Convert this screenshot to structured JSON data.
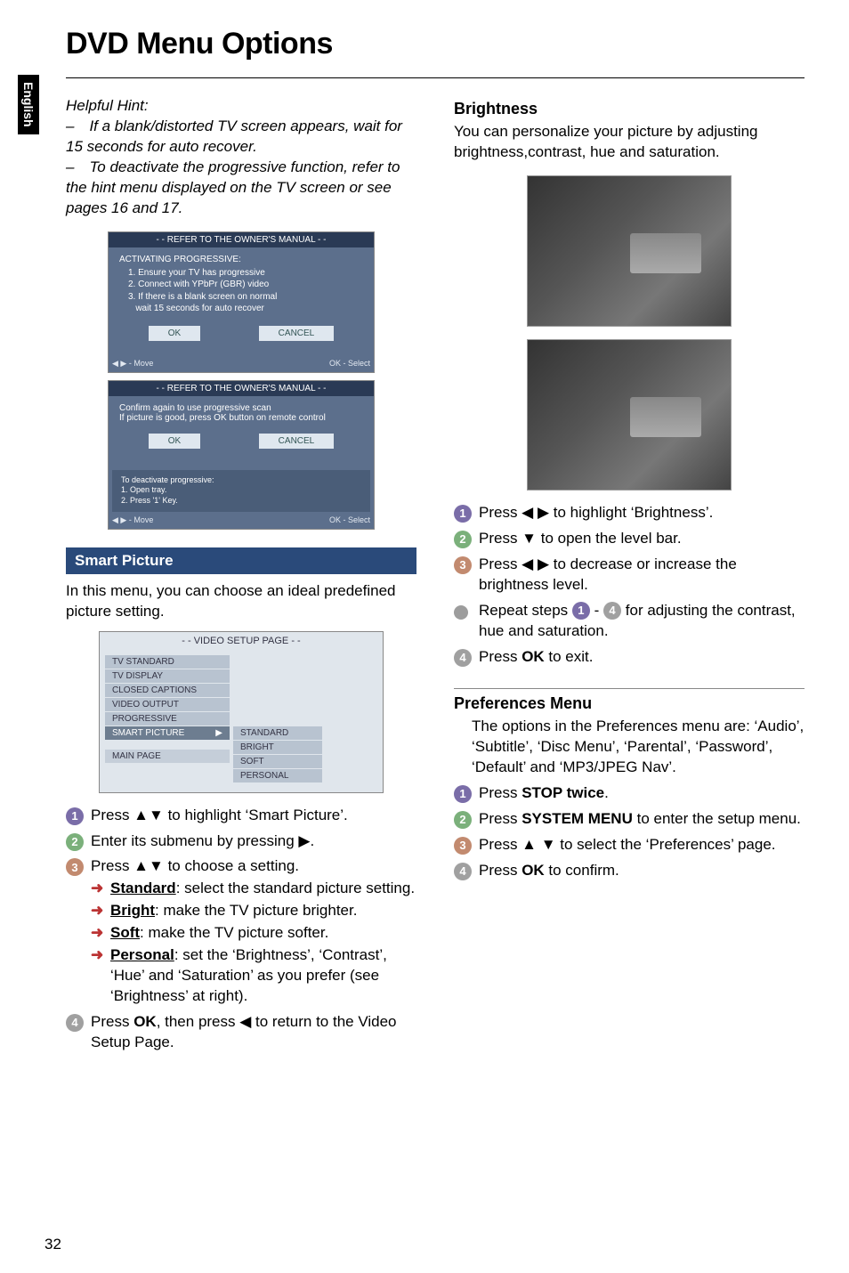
{
  "side_tab": "English",
  "page_title": "DVD Menu Options",
  "hint": {
    "label": "Helpful Hint:",
    "l1": "– If a blank/distorted TV screen appears, wait for 15 seconds for auto recover.",
    "l2": "– To deactivate the progressive function, refer to the hint menu displayed on the TV screen or see pages 16 and 17."
  },
  "panel1": {
    "title": "- - REFER TO THE OWNER'S MANUAL - -",
    "heading": "ACTIVATING PROGRESSIVE:",
    "items": [
      "1. Ensure your TV has progressive",
      "2. Connect with YPbPr (GBR) video",
      "3. If there is a blank screen on normal",
      "   wait 15 seconds for auto recover"
    ],
    "ok": "OK",
    "cancel": "CANCEL",
    "foot_move": "◀ ▶ - Move",
    "foot_sel": "OK - Select"
  },
  "panel2": {
    "title": "- - REFER TO THE OWNER'S MANUAL - -",
    "line1": "Confirm again to use progressive scan",
    "line2": "If picture is good, press OK button on remote control",
    "ok": "OK",
    "cancel": "CANCEL",
    "foot_heading": "To deactivate progressive:",
    "foot1": "1. Open tray.",
    "foot2": "2. Press '1' Key.",
    "foot_move": "◀ ▶ - Move",
    "foot_sel": "OK - Select"
  },
  "smart_pic": {
    "bar": "Smart Picture",
    "intro": "In this menu, you can choose an ideal predefined picture setting."
  },
  "video_setup": {
    "title": "- - VIDEO SETUP PAGE - -",
    "left": [
      "TV STANDARD",
      "TV DISPLAY",
      "CLOSED CAPTIONS",
      "VIDEO OUTPUT",
      "PROGRESSIVE",
      "SMART PICTURE"
    ],
    "right": [
      "STANDARD",
      "BRIGHT",
      "SOFT",
      "PERSONAL"
    ],
    "main": "MAIN PAGE"
  },
  "left_steps": {
    "s1": " to highlight ‘Smart Picture’.",
    "s1_pre": "Press ▲▼",
    "s2": "Enter its submenu by pressing ▶.",
    "s3_pre": "Press ▲▼",
    "s3": " to choose a setting.",
    "a1_label": "Standard",
    "a1_rest": ": select the standard picture setting.",
    "a2_label": "Bright",
    "a2_rest": ": make the TV picture brighter.",
    "a3_label": "Soft",
    "a3_rest": ": make the TV picture softer.",
    "a4_label": "Personal",
    "a4_rest": ": set the ‘Brightness’, ‘Contrast’, ‘Hue’ and ‘Saturation’ as you prefer (see ‘Brightness’ at right).",
    "s4_pre": "Press ",
    "s4_ok": "OK",
    "s4_mid": ", then press ◀ to return to the Video Setup Page."
  },
  "brightness": {
    "heading": "Brightness",
    "intro": "You can personalize your picture by adjusting brightness,contrast, hue and saturation."
  },
  "right_steps": {
    "s1": "Press ◀ ▶ to highlight ‘Brightness’.",
    "s2": "Press ▼ to open the level bar.",
    "s3": "Press ◀ ▶ to decrease or increase the brightness level.",
    "bullet_pre": "Repeat steps ",
    "bullet_post": " for adjusting the contrast, hue and saturation.",
    "s4_pre": "Press ",
    "s4_ok": "OK",
    "s4_post": " to exit."
  },
  "prefs": {
    "heading": "Preferences Menu",
    "intro": "The options in the Preferences menu are: ‘Audio’, ‘Subtitle’, ‘Disc Menu’, ‘Parental’, ‘Password’, ‘Default’ and ‘MP3/JPEG Nav’.",
    "s1_pre": "Press ",
    "s1_b": "STOP twice",
    "s1_post": ".",
    "s2_pre": "Press ",
    "s2_b": "SYSTEM MENU",
    "s2_post": " to enter the setup menu.",
    "s3": "Press ▲ ▼ to select the ‘Preferences’ page.",
    "s4_pre": "Press ",
    "s4_b": "OK",
    "s4_post": " to confirm."
  },
  "page_number": "32"
}
